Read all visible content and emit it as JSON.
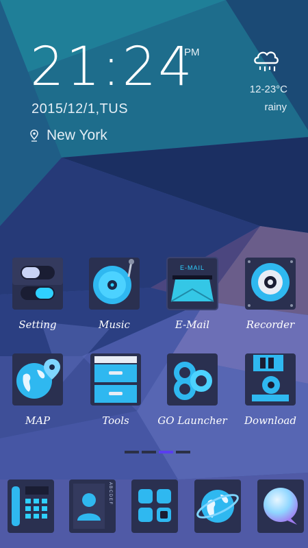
{
  "clock": {
    "time": "21:24",
    "ampm": "PM"
  },
  "date": "2015/12/1,TUS",
  "location": {
    "city": "New York",
    "icon": "location-pin-icon"
  },
  "weather": {
    "icon": "rain-cloud-icon",
    "temp": "12-23°C",
    "condition": "rainy"
  },
  "apps": [
    {
      "label": "Setting",
      "icon": "toggle-switches-icon"
    },
    {
      "label": "Music",
      "icon": "turntable-disc-icon"
    },
    {
      "label": "E-Mail",
      "icon": "mail-slot-icon",
      "icon_text": "E-MAIL"
    },
    {
      "label": "Recorder",
      "icon": "cassette-reel-icon"
    },
    {
      "label": "MAP",
      "icon": "globe-pin-icon"
    },
    {
      "label": "Tools",
      "icon": "drawer-cabinet-icon"
    },
    {
      "label": "GO Launcher",
      "icon": "go-loop-icon"
    },
    {
      "label": "Download",
      "icon": "floppy-disk-icon"
    }
  ],
  "pager": {
    "pages": 4,
    "active_index": 2
  },
  "dock": [
    {
      "icon": "phone-keypad-icon"
    },
    {
      "icon": "contacts-book-icon",
      "index_letters": "A B C D E F"
    },
    {
      "icon": "app-grid-icon"
    },
    {
      "icon": "browser-globe-icon"
    },
    {
      "icon": "message-bubble-icon"
    }
  ],
  "colors": {
    "accent_cyan": "#2fd0ff",
    "pager_active": "#5a3df0",
    "pager_inactive": "#2b3046"
  }
}
